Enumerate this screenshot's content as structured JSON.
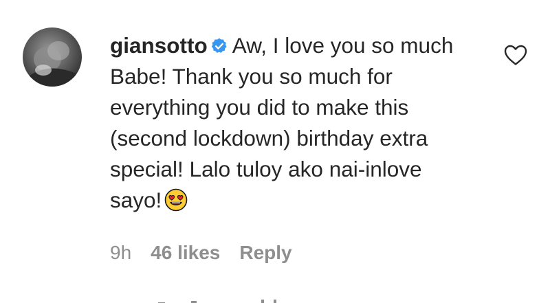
{
  "comment": {
    "username": "giansotto",
    "verified": true,
    "text_before_emoji": "Aw, I love you so much Babe! Thank you so much for everything you did to make this (second lockdown) birthday extra special! Lalo tuloy ako nai-inlove sayo!",
    "emoji": "smiling-face-with-heart-eyes",
    "time": "9h",
    "likes": "46 likes",
    "reply_label": "Reply"
  },
  "icons": {
    "like": "heart-outline-icon",
    "verified": "verified-badge-icon"
  },
  "colors": {
    "text": "#262626",
    "secondary": "#8e8e8e",
    "verified_blue": "#3897f0"
  }
}
